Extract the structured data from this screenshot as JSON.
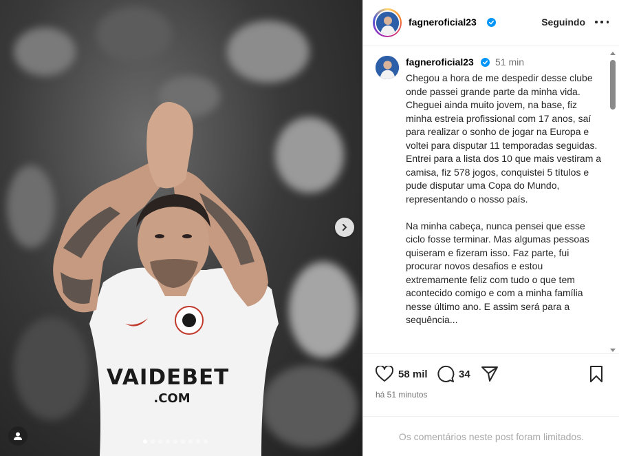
{
  "post": {
    "username": "fagneroficial23",
    "follow_label": "Seguindo",
    "time_ago": "51 min",
    "caption": "Chegou a hora de me despedir desse clube onde passei grande parte da minha vida. Cheguei ainda muito jovem, na base, fiz minha estreia profissional com 17 anos, saí para realizar o sonho de jogar na Europa e voltei para disputar 11 temporadas seguidas. Entrei para a lista dos 10 que mais vestiram a camisa, fiz 578 jogos, conquistei 5 títulos e pude disputar uma Copa do Mundo, representando o nosso país.\n\nNa minha cabeça, nunca pensei que esse ciclo fosse terminar. Mas algumas pessoas quiseram e fizeram isso. Faz parte, fui procurar novos desafios e estou extremamente feliz com tudo o que tem acontecido comigo e com a minha família nesse último ano. E assim será para a sequência...",
    "likes": "58 mil",
    "comments_count": "34",
    "posted": "há 51 minutos",
    "comments_limited": "Os comentários neste post foram limitados."
  },
  "media": {
    "jersey_sponsor_line1": "VAIDEBET",
    "jersey_sponsor_line2": ".COM",
    "carousel_count": 9,
    "carousel_active": 1
  },
  "icons": {
    "verified": "verified-badge-icon",
    "more": "more-options-icon",
    "like": "heart-icon",
    "comment": "comment-bubble-icon",
    "share": "paper-plane-icon",
    "save": "bookmark-icon",
    "next": "chevron-right-icon",
    "tagged": "user-tag-icon"
  },
  "colors": {
    "verified_blue": "#0095f6",
    "text_primary": "#262626",
    "text_secondary": "#737373",
    "text_muted": "#a8a8a8"
  }
}
